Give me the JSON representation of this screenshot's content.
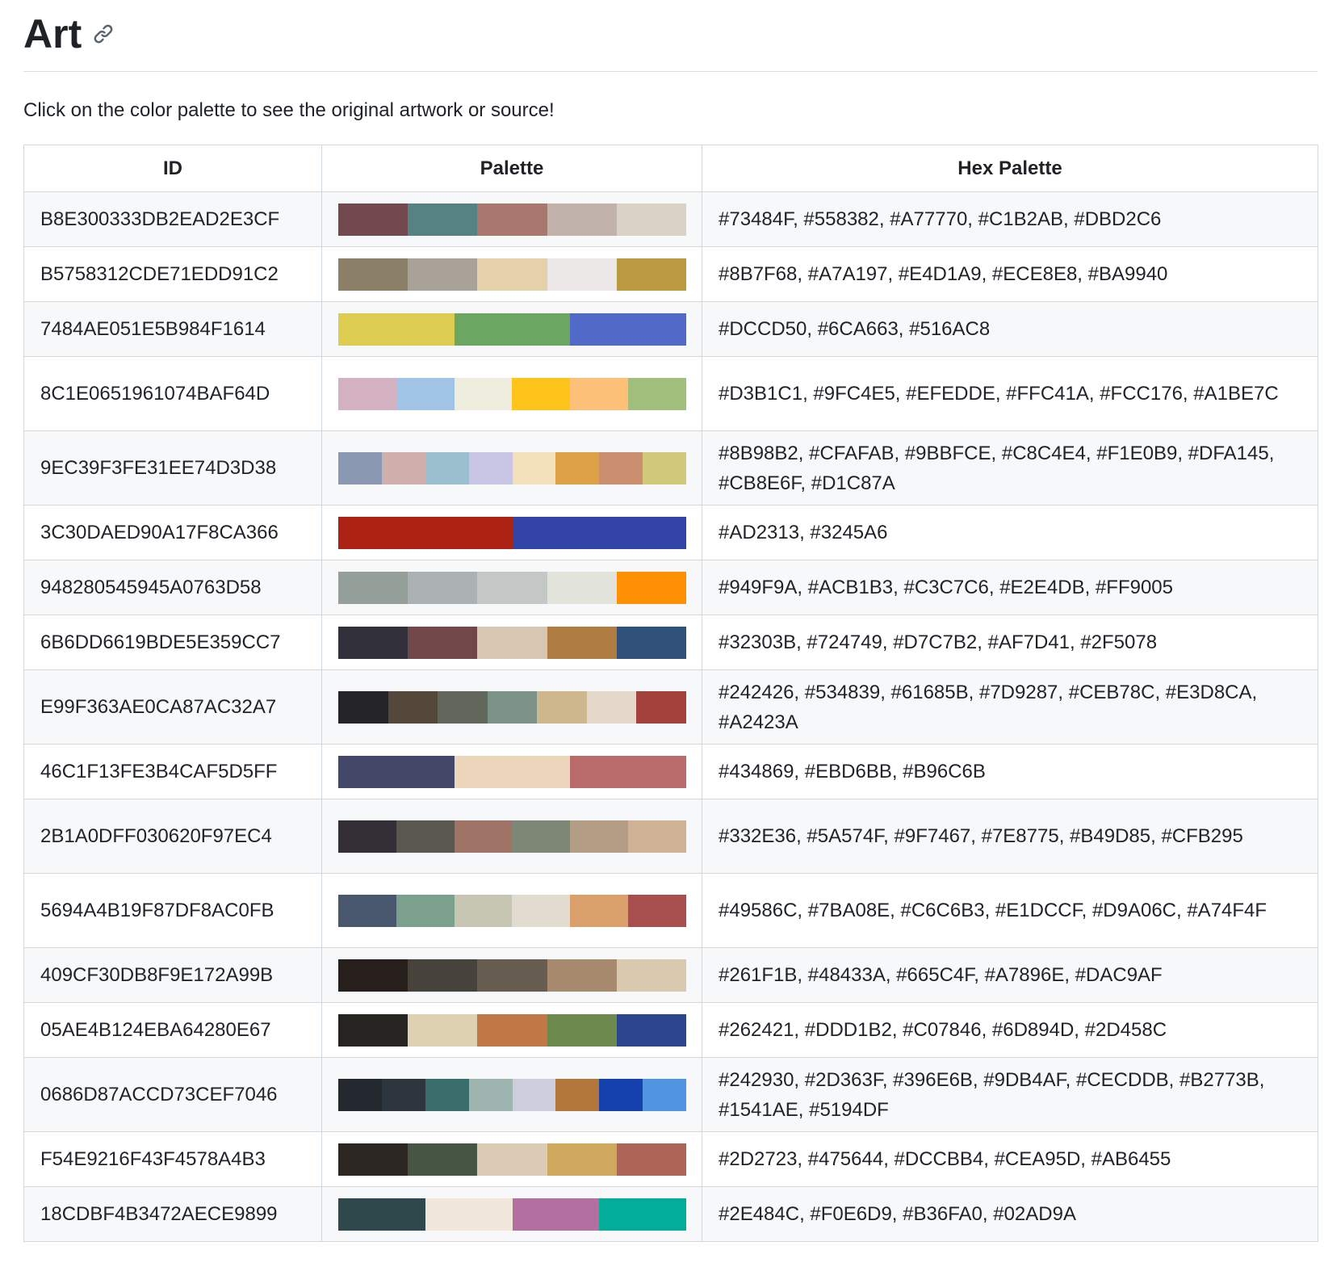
{
  "heading": "Art",
  "intro": "Click on the color palette to see the original artwork or source!",
  "table": {
    "headers": [
      "ID",
      "Palette",
      "Hex Palette"
    ],
    "rows": [
      {
        "id": "B8E300333DB2EAD2E3CF",
        "hex": "#73484F, #558382, #A77770, #C1B2AB, #DBD2C6",
        "colors": [
          "#73484F",
          "#558382",
          "#A77770",
          "#C1B2AB",
          "#DBD2C6"
        ]
      },
      {
        "id": "B5758312CDE71EDD91C2",
        "hex": "#8B7F68, #A7A197, #E4D1A9, #ECE8E8, #BA9940",
        "colors": [
          "#8B7F68",
          "#A7A197",
          "#E4D1A9",
          "#ECE8E8",
          "#BA9940"
        ]
      },
      {
        "id": "7484AE051E5B984F1614",
        "hex": "#DCCD50, #6CA663, #516AC8",
        "colors": [
          "#DCCD50",
          "#6CA663",
          "#516AC8"
        ]
      },
      {
        "id": "8C1E0651961074BAF64D",
        "hex": "#D3B1C1, #9FC4E5, #EFEDDE, #FFC41A, #FCC176, #A1BE7C",
        "colors": [
          "#D3B1C1",
          "#9FC4E5",
          "#EFEDDE",
          "#FFC41A",
          "#FCC176",
          "#A1BE7C"
        ]
      },
      {
        "id": "9EC39F3FE31EE74D3D38",
        "hex": "#8B98B2, #CFAFAB, #9BBFCE, #C8C4E4, #F1E0B9, #DFA145, #CB8E6F, #D1C87A",
        "colors": [
          "#8B98B2",
          "#CFAFAB",
          "#9BBFCE",
          "#C8C4E4",
          "#F1E0B9",
          "#DFA145",
          "#CB8E6F",
          "#D1C87A"
        ]
      },
      {
        "id": "3C30DAED90A17F8CA366",
        "hex": "#AD2313, #3245A6",
        "colors": [
          "#AD2313",
          "#3245A6"
        ]
      },
      {
        "id": "948280545945A0763D58",
        "hex": "#949F9A, #ACB1B3, #C3C7C6, #E2E4DB, #FF9005",
        "colors": [
          "#949F9A",
          "#ACB1B3",
          "#C3C7C6",
          "#E2E4DB",
          "#FF9005"
        ]
      },
      {
        "id": "6B6DD6619BDE5E359CC7",
        "hex": "#32303B, #724749, #D7C7B2, #AF7D41, #2F5078",
        "colors": [
          "#32303B",
          "#724749",
          "#D7C7B2",
          "#AF7D41",
          "#2F5078"
        ]
      },
      {
        "id": "E99F363AE0CA87AC32A7",
        "hex": "#242426, #534839, #61685B, #7D9287, #CEB78C, #E3D8CA, #A2423A",
        "colors": [
          "#242426",
          "#534839",
          "#61685B",
          "#7D9287",
          "#CEB78C",
          "#E3D8CA",
          "#A2423A"
        ]
      },
      {
        "id": "46C1F13FE3B4CAF5D5FF",
        "hex": "#434869, #EBD6BB, #B96C6B",
        "colors": [
          "#434869",
          "#EBD6BB",
          "#B96C6B"
        ]
      },
      {
        "id": "2B1A0DFF030620F97EC4",
        "hex": "#332E36, #5A574F, #9F7467, #7E8775, #B49D85, #CFB295",
        "colors": [
          "#332E36",
          "#5A574F",
          "#9F7467",
          "#7E8775",
          "#B49D85",
          "#CFB295"
        ]
      },
      {
        "id": "5694A4B19F87DF8AC0FB",
        "hex": "#49586C, #7BA08E, #C6C6B3, #E1DCCF, #D9A06C, #A74F4F",
        "colors": [
          "#49586C",
          "#7BA08E",
          "#C6C6B3",
          "#E1DCCF",
          "#D9A06C",
          "#A74F4F"
        ]
      },
      {
        "id": "409CF30DB8F9E172A99B",
        "hex": "#261F1B, #48433A, #665C4F, #A7896E, #DAC9AF",
        "colors": [
          "#261F1B",
          "#48433A",
          "#665C4F",
          "#A7896E",
          "#DAC9AF"
        ]
      },
      {
        "id": "05AE4B124EBA64280E67",
        "hex": "#262421, #DDD1B2, #C07846, #6D894D, #2D458C",
        "colors": [
          "#262421",
          "#DDD1B2",
          "#C07846",
          "#6D894D",
          "#2D458C"
        ]
      },
      {
        "id": "0686D87ACCD73CEF7046",
        "hex": "#242930, #2D363F, #396E6B, #9DB4AF, #CECDDB, #B2773B, #1541AE, #5194DF",
        "colors": [
          "#242930",
          "#2D363F",
          "#396E6B",
          "#9DB4AF",
          "#CECDDB",
          "#B2773B",
          "#1541AE",
          "#5194DF"
        ]
      },
      {
        "id": "F54E9216F43F4578A4B3",
        "hex": "#2D2723, #475644, #DCCBB4, #CEA95D, #AB6455",
        "colors": [
          "#2D2723",
          "#475644",
          "#DCCBB4",
          "#CEA95D",
          "#AB6455"
        ]
      },
      {
        "id": "18CDBF4B3472AECE9899",
        "hex": "#2E484C, #F0E6D9, #B36FA0, #02AD9A",
        "colors": [
          "#2E484C",
          "#F0E6D9",
          "#B36FA0",
          "#02AD9A"
        ]
      }
    ]
  }
}
